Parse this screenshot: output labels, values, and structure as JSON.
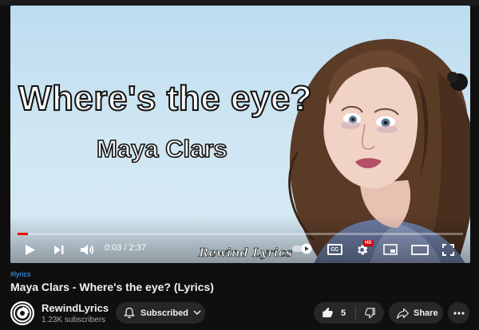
{
  "video": {
    "overlay_title": "Where's the eye?",
    "overlay_artist": "Maya Clars",
    "watermark": "Rewind Lyrics",
    "progress_fraction": 0.023
  },
  "player": {
    "time_display": "0:03 / 2:37",
    "cc_label": "CC",
    "hd_badge": "HD"
  },
  "meta": {
    "hashtag": "#lyrics",
    "title": "Maya Clars - Where's the eye? (Lyrics)"
  },
  "channel": {
    "name": "RewindLyrics",
    "subscribers": "1.23K subscribers",
    "subscribe_label": "Subscribed"
  },
  "actions": {
    "like_count": "5",
    "share_label": "Share"
  },
  "colors": {
    "accent_red": "#ff0000",
    "link_blue": "#3ea6ff",
    "pill_bg": "#272727"
  },
  "icons": [
    "play-icon",
    "next-icon",
    "volume-icon",
    "autoplay-toggle-icon",
    "captions-icon",
    "settings-icon",
    "miniplayer-icon",
    "theater-icon",
    "fullscreen-icon",
    "bell-icon",
    "chevron-down-icon",
    "thumbs-up-icon",
    "thumbs-down-icon",
    "share-icon",
    "more-icon"
  ]
}
